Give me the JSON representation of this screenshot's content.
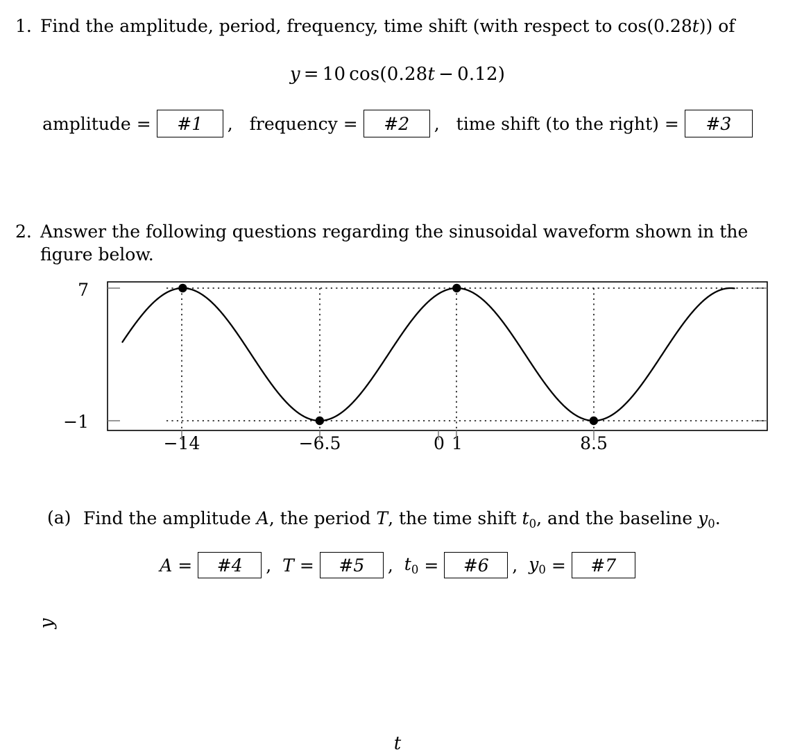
{
  "problem1": {
    "number": "1.",
    "text_before": "Find the amplitude, period, frequency, time shift (with respect to cos(0.28",
    "text_var": "t",
    "text_after": ")) of",
    "equation": {
      "lhs": "y",
      "eq": "=",
      "coefficient": "10",
      "func": "cos",
      "open_paren": "(",
      "inner_coefficient": "0.28",
      "inner_var": "t",
      "minus": "−",
      "inner_const": "0.12",
      "close_paren": ")",
      "full": "y = 10 cos(0.28t − 0.12)"
    },
    "answers": [
      {
        "label": "amplitude",
        "eq": "=",
        "box": "#1",
        "sep": ","
      },
      {
        "label": "frequency",
        "eq": "=",
        "box": "#2",
        "sep": ","
      },
      {
        "label": "time shift (to the right)",
        "eq": "=",
        "box": "#3",
        "sep": ""
      }
    ]
  },
  "problem2": {
    "number": "2.",
    "line1": "Answer the following questions regarding the sinusoidal waveform shown in the",
    "line2": "figure below.",
    "part_a": {
      "label": "(a)",
      "text_1": "Find the amplitude ",
      "var_A": "A",
      "text_2": ", the period ",
      "var_T": "T",
      "text_3": ", the time shift ",
      "var_t": "t",
      "var_t_sub": "0",
      "text_4": ", and the baseline ",
      "var_y": "y",
      "var_y_sub": "0",
      "text_5": "."
    },
    "answers": [
      {
        "var": "A",
        "sub": "",
        "eq": "=",
        "box": "#4",
        "sep": ","
      },
      {
        "var": "T",
        "sub": "",
        "eq": "=",
        "box": "#5",
        "sep": ","
      },
      {
        "var": "t",
        "sub": "0",
        "eq": "=",
        "box": "#6",
        "sep": ","
      },
      {
        "var": "y",
        "sub": "0",
        "eq": "=",
        "box": "#7",
        "sep": ""
      }
    ]
  },
  "chart_data": {
    "type": "line",
    "title": "",
    "xlabel": "t",
    "ylabel": "y",
    "xlim": [
      -17.3,
      19.0
    ],
    "ylim": [
      -1.8,
      7.9
    ],
    "x_ticks": [
      {
        "value": -14,
        "label": "−14"
      },
      {
        "value": -6.5,
        "label": "−6.5"
      },
      {
        "value": 0,
        "label": "0"
      },
      {
        "value": 1,
        "label": "1"
      },
      {
        "value": 8.5,
        "label": "8.5"
      }
    ],
    "y_ticks": [
      {
        "value": 7,
        "label": "7"
      },
      {
        "value": -1,
        "label": "−1"
      }
    ],
    "grid": "dotted",
    "gridlines_horizontal": [
      7,
      -1
    ],
    "gridlines_vertical": [
      -14,
      -6.5,
      1,
      8.5
    ],
    "sinusoid": {
      "amplitude": 4,
      "baseline": 3,
      "period": 15,
      "peak_time": 1,
      "max": 7,
      "min": -1,
      "equation": "y = 3 + 4 cos(2π(t − 1)/15)"
    },
    "markers": [
      {
        "x": -14,
        "y": 7,
        "type": "peak"
      },
      {
        "x": -6.5,
        "y": -1,
        "type": "trough"
      },
      {
        "x": 1,
        "y": 7,
        "type": "peak"
      },
      {
        "x": 8.5,
        "y": -1,
        "type": "trough"
      }
    ],
    "curve_visible_range": [
      -17.3,
      16.2
    ]
  },
  "colors": {
    "text": "#000000",
    "curve": "#000000",
    "grid": "#000000",
    "frame": "#000000",
    "tick": "#888888",
    "background": "#ffffff"
  }
}
